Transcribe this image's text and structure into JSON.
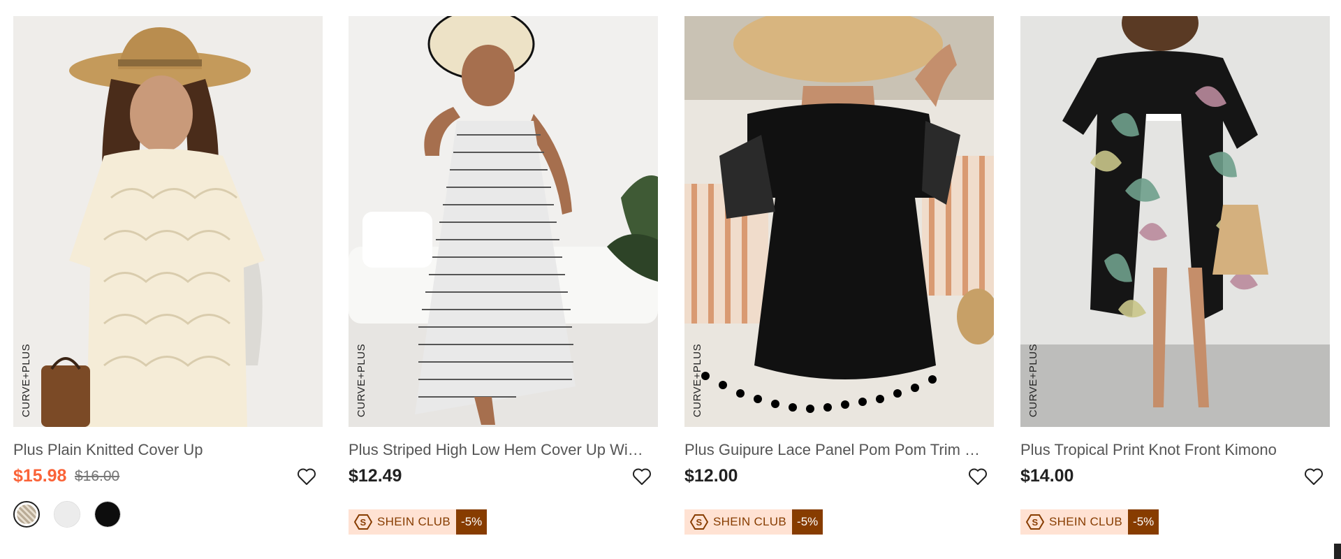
{
  "products": [
    {
      "title": "Plus Plain Knitted Cover Up",
      "brand_tag": "CURVE+PLUS",
      "price": "$15.98",
      "original_price": "$16.00",
      "on_sale": true,
      "swatches": [
        "beige-knit",
        "white",
        "black"
      ],
      "selected_swatch": 0
    },
    {
      "title": "Plus Striped High Low Hem Cover Up Wi…",
      "brand_tag": "CURVE+PLUS",
      "price": "$12.49",
      "club_label": "SHEIN CLUB",
      "club_discount": "-5%"
    },
    {
      "title": "Plus Guipure Lace Panel Pom Pom Trim …",
      "brand_tag": "CURVE+PLUS",
      "price": "$12.00",
      "club_label": "SHEIN CLUB",
      "club_discount": "-5%"
    },
    {
      "title": "Plus Tropical Print Knot Front Kimono",
      "brand_tag": "CURVE+PLUS",
      "price": "$14.00",
      "club_label": "SHEIN CLUB",
      "club_discount": "-5%"
    }
  ],
  "colors": {
    "sale_price": "#fa6338",
    "club_bg": "#ffe2d3",
    "club_accent": "#873c00"
  },
  "icons": {
    "wishlist": "heart-outline-icon",
    "club": "shein-club-logo-icon"
  }
}
